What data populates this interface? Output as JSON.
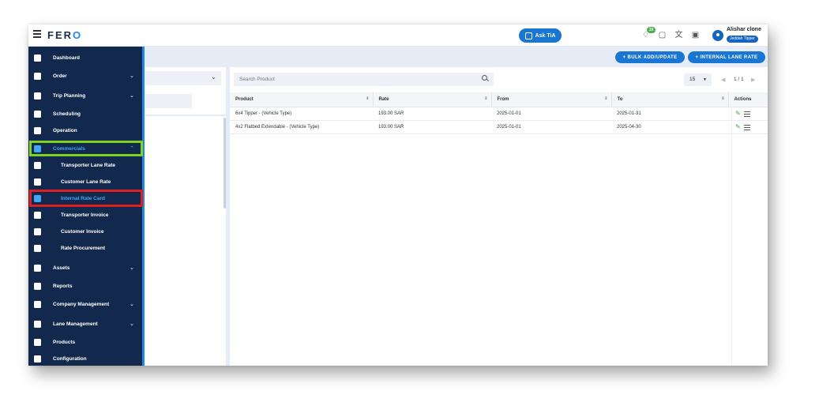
{
  "app": {
    "logo_prefix": "FER",
    "logo_suffix": "O"
  },
  "topbar": {
    "ask_label": "Ask TiA",
    "notification_count": "19",
    "user_name": "Alishar clone",
    "user_role": "Jeddah Tipper"
  },
  "sidebar": {
    "items": [
      {
        "label": "Dashboard",
        "icon": "dashboard-icon"
      },
      {
        "label": "Order",
        "icon": "order-icon"
      },
      {
        "label": "Trip Planning",
        "icon": "trip-planning-icon"
      },
      {
        "label": "Scheduling",
        "icon": "scheduling-icon"
      },
      {
        "label": "Operation",
        "icon": "operation-icon"
      },
      {
        "label": "Commercials",
        "icon": "commercials-icon"
      },
      {
        "label": "Transporter Lane Rate",
        "icon": "truck-icon"
      },
      {
        "label": "Customer Lane Rate",
        "icon": "customer-rate-icon"
      },
      {
        "label": "Internal Rate Card",
        "icon": "rate-card-icon"
      },
      {
        "label": "Transporter Invoice",
        "icon": "invoice-icon"
      },
      {
        "label": "Customer Invoice",
        "icon": "customer-invoice-icon"
      },
      {
        "label": "Rate Procurement",
        "icon": "procurement-icon"
      },
      {
        "label": "Assets",
        "icon": "assets-icon"
      },
      {
        "label": "Reports",
        "icon": "reports-icon"
      },
      {
        "label": "Company Management",
        "icon": "company-icon"
      },
      {
        "label": "Lane Management",
        "icon": "lane-icon"
      },
      {
        "label": "Products",
        "icon": "products-icon"
      },
      {
        "label": "Configuration",
        "icon": "gear-icon"
      }
    ]
  },
  "toolbar": {
    "bulk_label": "+ BULK ADD/UPDATE",
    "internal_lane_label": "+ INTERNAL LANE RATE"
  },
  "search": {
    "placeholder": "Search Product"
  },
  "pager": {
    "page_size": "15",
    "info": "1 / 1"
  },
  "table": {
    "headers": [
      "Product",
      "Rate",
      "From",
      "To",
      "Actions"
    ],
    "rows": [
      {
        "product": "6x4 Tipper - (Vehicle Type)",
        "rate": "193.00 SAR",
        "from": "2025-01-01",
        "to": "2025-01-31"
      },
      {
        "product": "4x2 Flatbed Extendable - (Vehicle Type)",
        "rate": "193.00 SAR",
        "from": "2025-01-01",
        "to": "2025-04-30"
      }
    ]
  },
  "colors": {
    "sidebar_bg": "#12294d",
    "accent": "#1976d2",
    "active": "#42a5f5",
    "highlight_green": "#7ed321",
    "highlight_red": "#e02020"
  }
}
